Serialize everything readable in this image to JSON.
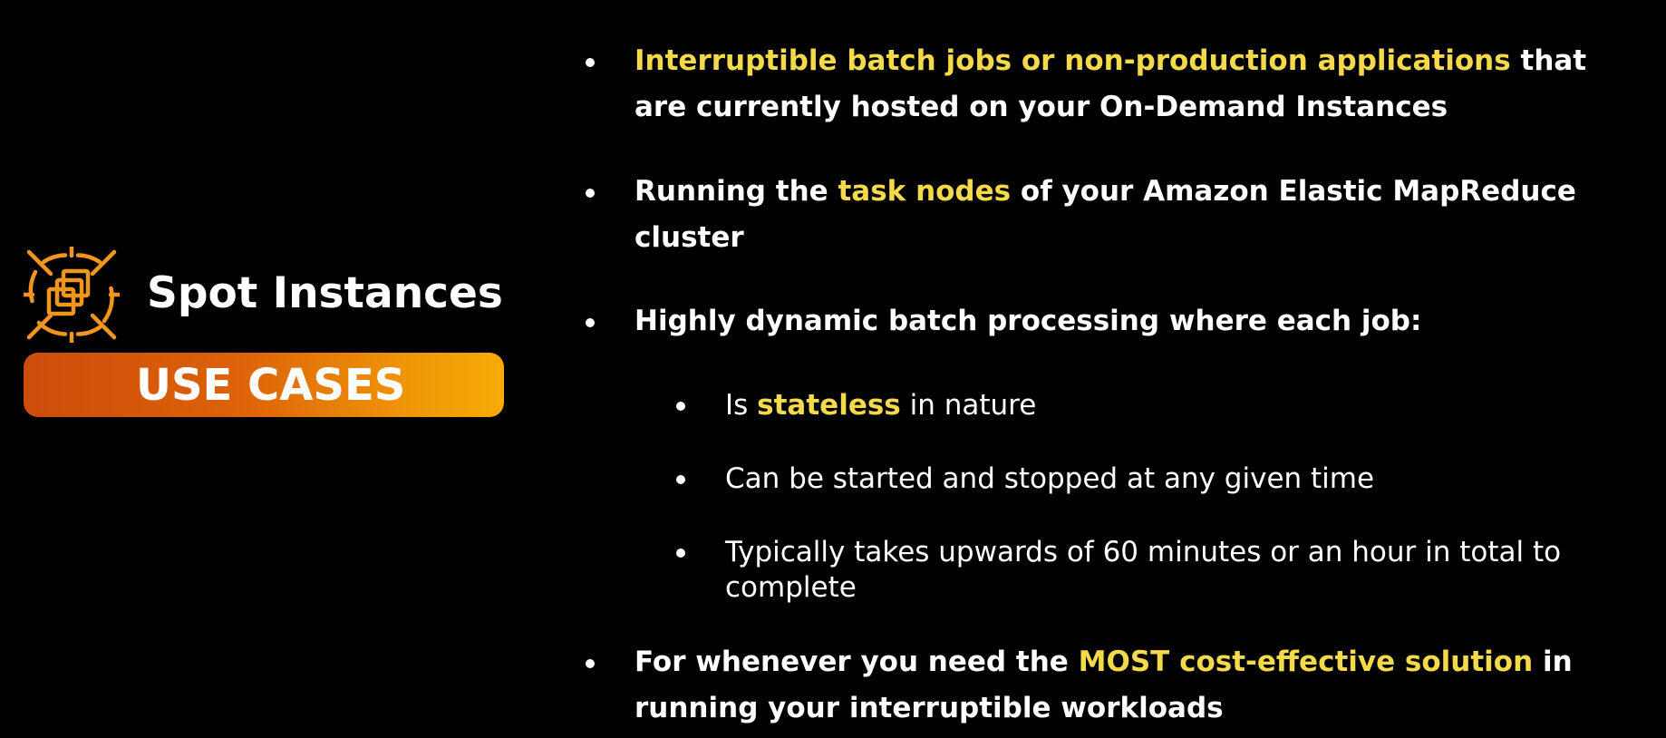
{
  "header": {
    "title": "Spot Instances",
    "banner_label": "USE CASES",
    "icon": "spot-instance-icon",
    "accent_color": "#f0961e",
    "banner_gradient": [
      "#cc4d0b",
      "#f6ab06"
    ]
  },
  "highlight_color": "#f4d94a",
  "bullets": [
    {
      "line1_highlight": "Interruptible batch jobs or non-production applications",
      "line1_after": " that",
      "line2": "are currently hosted on your On-Demand Instances"
    },
    {
      "line1_before": "Running the ",
      "line1_highlight": "task nodes",
      "line1_after": " of your Amazon Elastic MapReduce",
      "line2": "cluster"
    },
    {
      "line1": "Highly dynamic batch processing where each job:",
      "subitems": [
        {
          "before": "Is ",
          "highlight": "stateless",
          "after": " in nature"
        },
        {
          "text": "Can be started and stopped at any given time"
        },
        {
          "line1": "Typically takes upwards of 60 minutes or an hour in total to",
          "line2": "complete"
        }
      ]
    },
    {
      "line1_before": "For whenever you need the ",
      "line1_highlight": "MOST cost-effective solution",
      "line1_after": " in",
      "line2": "running your interruptible workloads"
    }
  ]
}
